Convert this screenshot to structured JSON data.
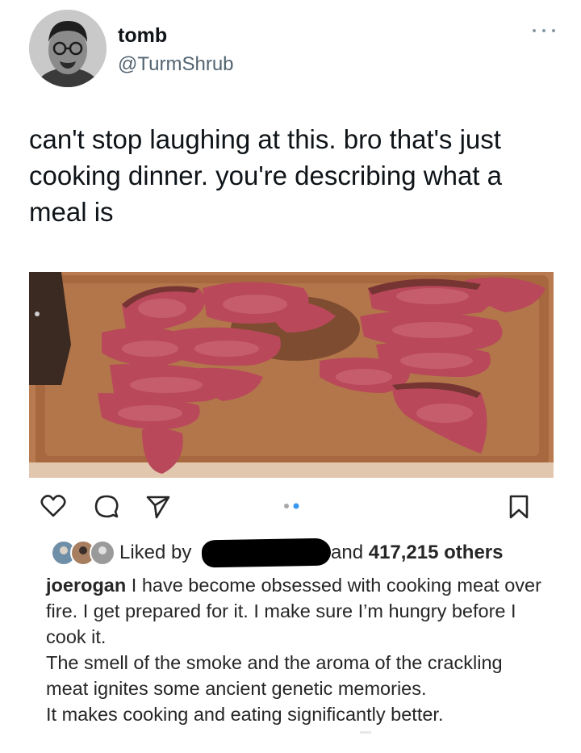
{
  "tweet": {
    "display_name": "tomb",
    "handle": "@TurmShrub",
    "text": "can't stop laughing at this. bro that's just cooking dinner. you're describing what a meal is"
  },
  "instagram": {
    "liked_prefix": "Liked by",
    "liked_and": "and",
    "liked_count": "417,215 others",
    "caption_user": "joerogan",
    "caption_first": "I have become obsessed with cooking meat over fire.  I get prepared for it.  I make sure I’m hungry before I cook it.",
    "caption_second": "The smell of the smoke and the aroma of the crackling meat ignites some ancient genetic memories.",
    "caption_third": "It makes cooking and eating significantly better."
  },
  "icons": {
    "more": "more-horizontal-icon",
    "like": "heart-icon",
    "comment": "comment-icon",
    "share": "send-icon",
    "bookmark": "bookmark-icon"
  },
  "colors": {
    "text": "#0f1419",
    "secondary": "#536471",
    "ig_text": "#262626",
    "carousel_active": "#3897f0"
  }
}
